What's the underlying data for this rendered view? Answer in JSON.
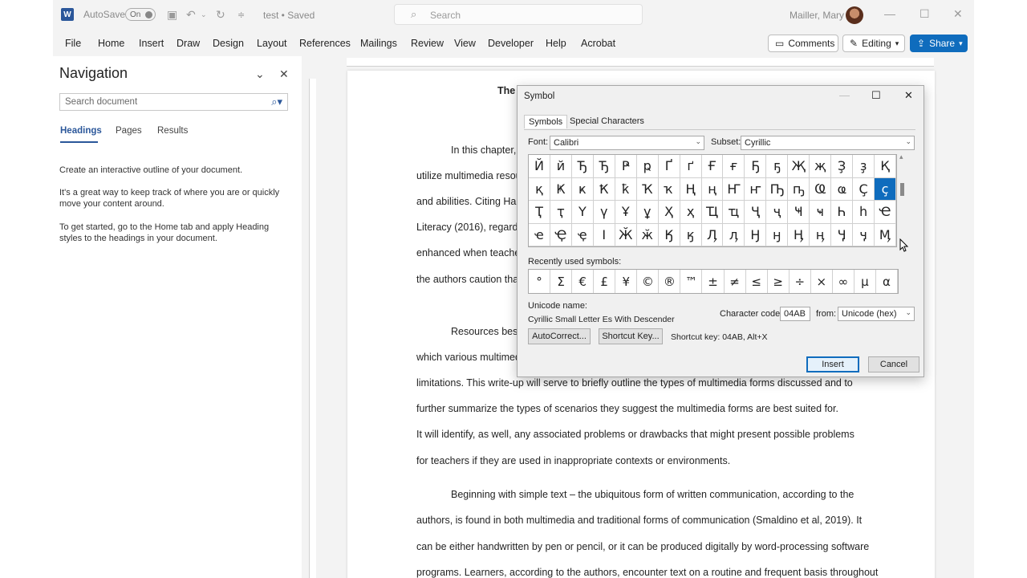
{
  "titlebar": {
    "logo": "W",
    "autosave_label": "AutoSave",
    "toggle_label": "On",
    "doc_title": "test • Saved",
    "search_placeholder": "Search",
    "user_name": "Mailler, Mary"
  },
  "menu": [
    "File",
    "Home",
    "Insert",
    "Draw",
    "Design",
    "Layout",
    "References",
    "Mailings",
    "Review",
    "View",
    "Developer",
    "Help",
    "Acrobat"
  ],
  "right_buttons": {
    "comments": "Comments",
    "editing": "Editing",
    "share": "Share"
  },
  "navigation": {
    "title": "Navigation",
    "search_placeholder": "Search document",
    "tabs": [
      "Headings",
      "Pages",
      "Results"
    ],
    "texts": [
      "Create an interactive outline of your document.",
      "It's a great way to keep track of where you are or quickly move your content around.",
      "To get started, go to the Home tab and apply Heading styles to the headings in your document."
    ]
  },
  "document": {
    "heading_fragment": "The",
    "lines": [
      {
        "text": "In this chapter,",
        "indent": true
      },
      {
        "text": "utilize multimedia resou"
      },
      {
        "text": "and abilities. Citing Han"
      },
      {
        "text": "Literacy (2016), regardi"
      },
      {
        "text": "enhanced when teache"
      },
      {
        "text": "the authors caution tha"
      },
      {
        "text": "Resources best",
        "indent": true
      },
      {
        "text": "which various multimed"
      },
      {
        "text": "limitations. This write-up will serve to briefly outline the types of multimedia forms discussed and to"
      },
      {
        "text": "further summarize the types of scenarios they suggest the multimedia forms are best suited for."
      },
      {
        "text": "It will identify, as well, any associated problems or drawbacks that might present possible problems"
      },
      {
        "text": "for teachers if they are used in inappropriate contexts or environments."
      },
      {
        "text": "Beginning with simple text – the ubiquitous form of written communication, according to the",
        "indent": true
      },
      {
        "text": "authors, is found in both multimedia and traditional forms of communication (Smaldino et al, 2019). It"
      },
      {
        "text": "can be either handwritten by pen or pencil, or it can be produced digitally by word-processing software"
      },
      {
        "text": "programs. Learners, according to the authors, encounter text on a routine and frequent basis throughout"
      }
    ]
  },
  "symbol_dialog": {
    "title": "Symbol",
    "tabs": [
      "Symbols",
      "Special Characters"
    ],
    "font_label": "Font:",
    "font_value": "Calibri",
    "subset_label": "Subset:",
    "subset_value": "Cyrillic",
    "symbols": [
      "Й",
      "й",
      "Ђ",
      "Ђ",
      "Ҏ",
      "ҏ",
      "Ґ",
      "ґ",
      "Ғ",
      "ғ",
      "Ҕ",
      "ҕ",
      "Җ",
      "җ",
      "Ҙ",
      "ҙ",
      "Қ",
      "қ",
      "Ҝ",
      "ҝ",
      "Ҟ",
      "ҟ",
      "Ҡ",
      "ҡ",
      "Ң",
      "ң",
      "Ҥ",
      "ҥ",
      "Ҧ",
      "ҧ",
      "Ҩ",
      "ҩ",
      "Ҫ",
      "ҫ",
      "Ҭ",
      "ҭ",
      "Ү",
      "ү",
      "Ұ",
      "ұ",
      "Ҳ",
      "ҳ",
      "Ҵ",
      "ҵ",
      "Ҷ",
      "ҷ",
      "Ҹ",
      "ҹ",
      "Һ",
      "һ",
      "Ҽ",
      "ҽ",
      "Ҿ",
      "ҿ",
      "Ӏ",
      "Ӂ",
      "ӂ",
      "Ӄ",
      "ӄ",
      "Ӆ",
      "ӆ",
      "Ӈ",
      "ӈ",
      "Ӊ",
      "ӊ",
      "Ӌ",
      "ӌ",
      "Ӎ"
    ],
    "selected_symbol": "ҫ",
    "recent_label": "Recently used symbols:",
    "recent": [
      "°",
      "Σ",
      "€",
      "£",
      "¥",
      "©",
      "®",
      "™",
      "±",
      "≠",
      "≤",
      "≥",
      "÷",
      "×",
      "∞",
      "μ",
      "α"
    ],
    "unicode_name_label": "Unicode name:",
    "unicode_name": "Cyrillic Small Letter Es With Descender",
    "char_code_label": "Character code:",
    "char_code": "04AB",
    "from_label": "from:",
    "from_value": "Unicode (hex)",
    "autocorrect": "AutoCorrect...",
    "shortcut_key_btn": "Shortcut Key...",
    "shortcut_text": "Shortcut key: 04AB, Alt+X",
    "insert": "Insert",
    "cancel": "Cancel"
  },
  "colors": {
    "accent": "#2b579a",
    "share": "#0f6cbd",
    "selection": "#0f6cbd"
  }
}
